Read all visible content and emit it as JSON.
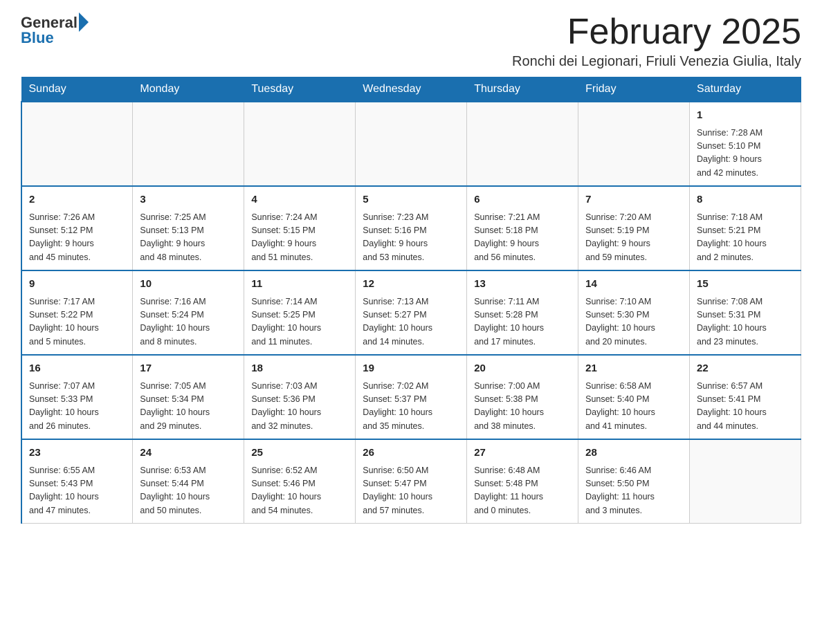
{
  "header": {
    "logo_general": "General",
    "logo_blue": "Blue",
    "month_title": "February 2025",
    "location": "Ronchi dei Legionari, Friuli Venezia Giulia, Italy"
  },
  "days_of_week": [
    "Sunday",
    "Monday",
    "Tuesday",
    "Wednesday",
    "Thursday",
    "Friday",
    "Saturday"
  ],
  "weeks": [
    {
      "days": [
        {
          "number": "",
          "info": ""
        },
        {
          "number": "",
          "info": ""
        },
        {
          "number": "",
          "info": ""
        },
        {
          "number": "",
          "info": ""
        },
        {
          "number": "",
          "info": ""
        },
        {
          "number": "",
          "info": ""
        },
        {
          "number": "1",
          "info": "Sunrise: 7:28 AM\nSunset: 5:10 PM\nDaylight: 9 hours\nand 42 minutes."
        }
      ]
    },
    {
      "days": [
        {
          "number": "2",
          "info": "Sunrise: 7:26 AM\nSunset: 5:12 PM\nDaylight: 9 hours\nand 45 minutes."
        },
        {
          "number": "3",
          "info": "Sunrise: 7:25 AM\nSunset: 5:13 PM\nDaylight: 9 hours\nand 48 minutes."
        },
        {
          "number": "4",
          "info": "Sunrise: 7:24 AM\nSunset: 5:15 PM\nDaylight: 9 hours\nand 51 minutes."
        },
        {
          "number": "5",
          "info": "Sunrise: 7:23 AM\nSunset: 5:16 PM\nDaylight: 9 hours\nand 53 minutes."
        },
        {
          "number": "6",
          "info": "Sunrise: 7:21 AM\nSunset: 5:18 PM\nDaylight: 9 hours\nand 56 minutes."
        },
        {
          "number": "7",
          "info": "Sunrise: 7:20 AM\nSunset: 5:19 PM\nDaylight: 9 hours\nand 59 minutes."
        },
        {
          "number": "8",
          "info": "Sunrise: 7:18 AM\nSunset: 5:21 PM\nDaylight: 10 hours\nand 2 minutes."
        }
      ]
    },
    {
      "days": [
        {
          "number": "9",
          "info": "Sunrise: 7:17 AM\nSunset: 5:22 PM\nDaylight: 10 hours\nand 5 minutes."
        },
        {
          "number": "10",
          "info": "Sunrise: 7:16 AM\nSunset: 5:24 PM\nDaylight: 10 hours\nand 8 minutes."
        },
        {
          "number": "11",
          "info": "Sunrise: 7:14 AM\nSunset: 5:25 PM\nDaylight: 10 hours\nand 11 minutes."
        },
        {
          "number": "12",
          "info": "Sunrise: 7:13 AM\nSunset: 5:27 PM\nDaylight: 10 hours\nand 14 minutes."
        },
        {
          "number": "13",
          "info": "Sunrise: 7:11 AM\nSunset: 5:28 PM\nDaylight: 10 hours\nand 17 minutes."
        },
        {
          "number": "14",
          "info": "Sunrise: 7:10 AM\nSunset: 5:30 PM\nDaylight: 10 hours\nand 20 minutes."
        },
        {
          "number": "15",
          "info": "Sunrise: 7:08 AM\nSunset: 5:31 PM\nDaylight: 10 hours\nand 23 minutes."
        }
      ]
    },
    {
      "days": [
        {
          "number": "16",
          "info": "Sunrise: 7:07 AM\nSunset: 5:33 PM\nDaylight: 10 hours\nand 26 minutes."
        },
        {
          "number": "17",
          "info": "Sunrise: 7:05 AM\nSunset: 5:34 PM\nDaylight: 10 hours\nand 29 minutes."
        },
        {
          "number": "18",
          "info": "Sunrise: 7:03 AM\nSunset: 5:36 PM\nDaylight: 10 hours\nand 32 minutes."
        },
        {
          "number": "19",
          "info": "Sunrise: 7:02 AM\nSunset: 5:37 PM\nDaylight: 10 hours\nand 35 minutes."
        },
        {
          "number": "20",
          "info": "Sunrise: 7:00 AM\nSunset: 5:38 PM\nDaylight: 10 hours\nand 38 minutes."
        },
        {
          "number": "21",
          "info": "Sunrise: 6:58 AM\nSunset: 5:40 PM\nDaylight: 10 hours\nand 41 minutes."
        },
        {
          "number": "22",
          "info": "Sunrise: 6:57 AM\nSunset: 5:41 PM\nDaylight: 10 hours\nand 44 minutes."
        }
      ]
    },
    {
      "days": [
        {
          "number": "23",
          "info": "Sunrise: 6:55 AM\nSunset: 5:43 PM\nDaylight: 10 hours\nand 47 minutes."
        },
        {
          "number": "24",
          "info": "Sunrise: 6:53 AM\nSunset: 5:44 PM\nDaylight: 10 hours\nand 50 minutes."
        },
        {
          "number": "25",
          "info": "Sunrise: 6:52 AM\nSunset: 5:46 PM\nDaylight: 10 hours\nand 54 minutes."
        },
        {
          "number": "26",
          "info": "Sunrise: 6:50 AM\nSunset: 5:47 PM\nDaylight: 10 hours\nand 57 minutes."
        },
        {
          "number": "27",
          "info": "Sunrise: 6:48 AM\nSunset: 5:48 PM\nDaylight: 11 hours\nand 0 minutes."
        },
        {
          "number": "28",
          "info": "Sunrise: 6:46 AM\nSunset: 5:50 PM\nDaylight: 11 hours\nand 3 minutes."
        },
        {
          "number": "",
          "info": ""
        }
      ]
    }
  ]
}
